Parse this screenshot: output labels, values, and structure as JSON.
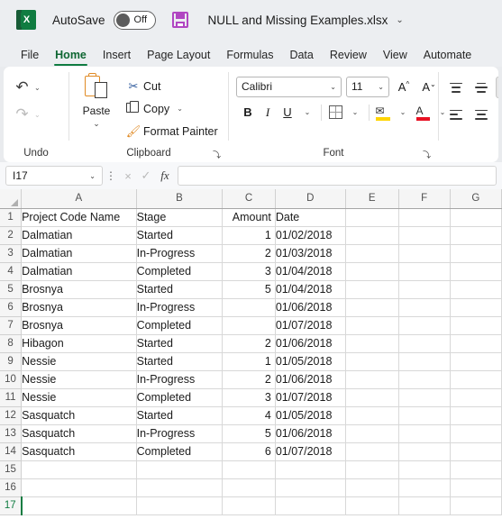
{
  "titlebar": {
    "app_icon": "excel-logo-icon",
    "autosave_label": "AutoSave",
    "autosave_state": "Off",
    "save_icon": "save-floppy-icon",
    "document_title": "NULL and Missing Examples.xlsx",
    "title_chevron": "⌄"
  },
  "tabs": [
    {
      "label": "File",
      "active": false
    },
    {
      "label": "Home",
      "active": true
    },
    {
      "label": "Insert",
      "active": false
    },
    {
      "label": "Page Layout",
      "active": false
    },
    {
      "label": "Formulas",
      "active": false
    },
    {
      "label": "Data",
      "active": false
    },
    {
      "label": "Review",
      "active": false
    },
    {
      "label": "View",
      "active": false
    },
    {
      "label": "Automate",
      "active": false
    }
  ],
  "ribbon": {
    "undo": {
      "group_label": "Undo",
      "undo_glyph": "↶",
      "redo_glyph": "↷",
      "chevron": "⌄"
    },
    "clipboard": {
      "group_label": "Clipboard",
      "paste_label": "Paste",
      "paste_chevron": "⌄",
      "cut_label": "Cut",
      "cut_icon": "scissors-icon",
      "copy_label": "Copy",
      "copy_icon": "copy-pages-icon",
      "copy_chevron": "⌄",
      "format_painter_label": "Format Painter",
      "format_painter_icon": "paintbrush-icon",
      "launcher": "⤵"
    },
    "font": {
      "group_label": "Font",
      "font_name": "Calibri",
      "font_size": "11",
      "chevron": "⌄",
      "grow_font_label": "A",
      "shrink_font_label": "A",
      "bold_label": "B",
      "italic_label": "I",
      "underline_label": "U",
      "borders_icon": "borders-icon",
      "fill_color_icon": "fill-color-icon",
      "fill_color": "#ffd400",
      "font_color_icon": "font-color-icon",
      "font_color": "#e81123",
      "launcher": "⤵"
    },
    "alignment": {
      "top_align": "align-top-icon",
      "middle_align": "align-middle-icon",
      "bottom_align": "align-bottom-icon",
      "left_align": "align-left-icon",
      "center_align": "align-center-icon",
      "right_align": "align-right-icon"
    }
  },
  "formula_bar": {
    "name_box_value": "I17",
    "name_box_chevron": "⌄",
    "dots": "⋮",
    "cancel_glyph": "×",
    "enter_glyph": "✓",
    "fx_label": "fx",
    "formula_value": ""
  },
  "sheet": {
    "columns": [
      "A",
      "B",
      "C",
      "D",
      "E",
      "F",
      "G"
    ],
    "active_row": 17,
    "rows": [
      {
        "n": 1,
        "cells": [
          "Project Code Name",
          "Stage",
          "Amount",
          "Date",
          "",
          "",
          ""
        ]
      },
      {
        "n": 2,
        "cells": [
          "Dalmatian",
          "Started",
          "1",
          "01/02/2018",
          "",
          "",
          ""
        ]
      },
      {
        "n": 3,
        "cells": [
          "Dalmatian",
          "In-Progress",
          "2",
          "01/03/2018",
          "",
          "",
          ""
        ]
      },
      {
        "n": 4,
        "cells": [
          "Dalmatian",
          "Completed",
          "3",
          "01/04/2018",
          "",
          "",
          ""
        ]
      },
      {
        "n": 5,
        "cells": [
          "Brosnya",
          "Started",
          "5",
          "01/04/2018",
          "",
          "",
          ""
        ]
      },
      {
        "n": 6,
        "cells": [
          "Brosnya",
          "In-Progress",
          "",
          "01/06/2018",
          "",
          "",
          ""
        ]
      },
      {
        "n": 7,
        "cells": [
          "Brosnya",
          "Completed",
          "",
          "01/07/2018",
          "",
          "",
          ""
        ]
      },
      {
        "n": 8,
        "cells": [
          "Hibagon",
          "Started",
          "2",
          "01/06/2018",
          "",
          "",
          ""
        ]
      },
      {
        "n": 9,
        "cells": [
          "Nessie",
          "Started",
          "1",
          "01/05/2018",
          "",
          "",
          ""
        ]
      },
      {
        "n": 10,
        "cells": [
          "Nessie",
          "In-Progress",
          "2",
          "01/06/2018",
          "",
          "",
          ""
        ]
      },
      {
        "n": 11,
        "cells": [
          "Nessie",
          "Completed",
          "3",
          "01/07/2018",
          "",
          "",
          ""
        ]
      },
      {
        "n": 12,
        "cells": [
          "Sasquatch",
          "Started",
          "4",
          "01/05/2018",
          "",
          "",
          ""
        ]
      },
      {
        "n": 13,
        "cells": [
          "Sasquatch",
          "In-Progress",
          "5",
          "01/06/2018",
          "",
          "",
          ""
        ]
      },
      {
        "n": 14,
        "cells": [
          "Sasquatch",
          "Completed",
          "6",
          "01/07/2018",
          "",
          "",
          ""
        ]
      },
      {
        "n": 15,
        "cells": [
          "",
          "",
          "",
          "",
          "",
          "",
          ""
        ]
      },
      {
        "n": 16,
        "cells": [
          "",
          "",
          "",
          "",
          "",
          "",
          ""
        ]
      },
      {
        "n": 17,
        "cells": [
          "",
          "",
          "",
          "",
          "",
          "",
          ""
        ]
      }
    ],
    "numeric_columns": [
      2
    ]
  },
  "colors": {
    "excel_green": "#107c41",
    "save_purple": "#b146c2",
    "orange_accent": "#e08a24"
  }
}
